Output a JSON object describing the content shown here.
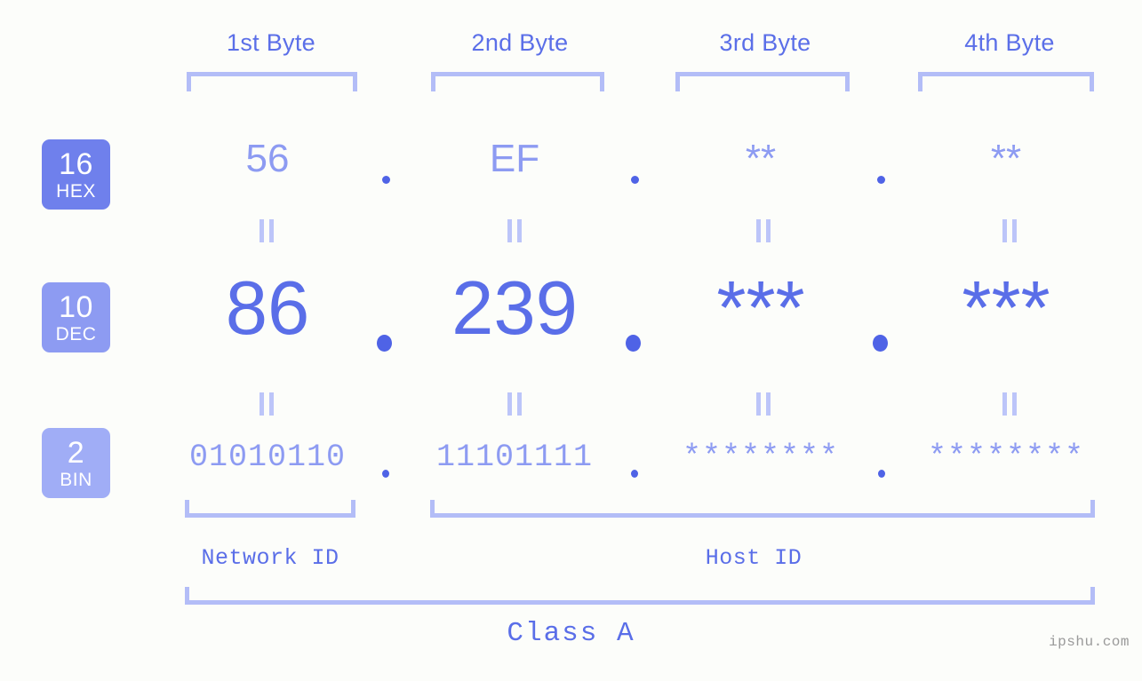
{
  "meta": {
    "background_color": "#fcfdfa",
    "accent_color": "#5a6ee8",
    "accent_light": "#8d9bf2",
    "bracket_color": "#b3bdf7"
  },
  "header": {
    "bytes": [
      {
        "label": "1st Byte"
      },
      {
        "label": "2nd Byte"
      },
      {
        "label": "3rd Byte"
      },
      {
        "label": "4th Byte"
      }
    ]
  },
  "rows": [
    {
      "id": "hex",
      "base_number": "16",
      "base_name": "HEX",
      "badge_color": "#6f80ec",
      "values": [
        "56",
        "EF",
        "**",
        "**"
      ],
      "separators": [
        ".",
        ".",
        "."
      ]
    },
    {
      "id": "dec",
      "base_number": "10",
      "base_name": "DEC",
      "badge_color": "#8d9bf2",
      "values": [
        "86",
        "239",
        "***",
        "***"
      ],
      "separators": [
        ".",
        ".",
        "."
      ]
    },
    {
      "id": "bin",
      "base_number": "2",
      "base_name": "BIN",
      "badge_color": "#a0adf6",
      "values": [
        "01010110",
        "11101111",
        "********",
        "********"
      ],
      "separators": [
        ".",
        ".",
        "."
      ]
    }
  ],
  "equals_connector": "||",
  "footer": {
    "network_id_label": "Network ID",
    "host_id_label": "Host ID",
    "class_label": "Class A",
    "watermark": "ipshu.com"
  }
}
